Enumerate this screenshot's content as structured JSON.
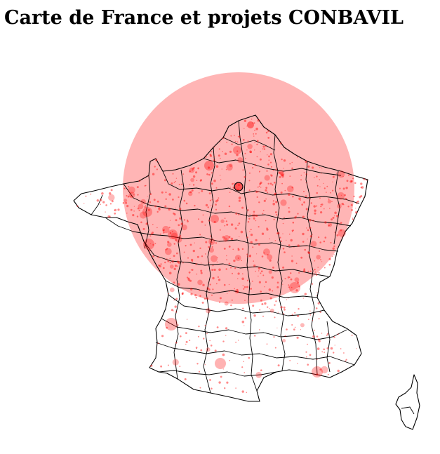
{
  "page": {
    "title": "Carte de France et projets CONBAVIL"
  },
  "map": {
    "country": "France",
    "region_detail": "départements",
    "colors": {
      "background": "#ffffff",
      "outline": "#000000",
      "project_marker": "#ff0000",
      "large_overlay": "#ff9999"
    }
  }
}
